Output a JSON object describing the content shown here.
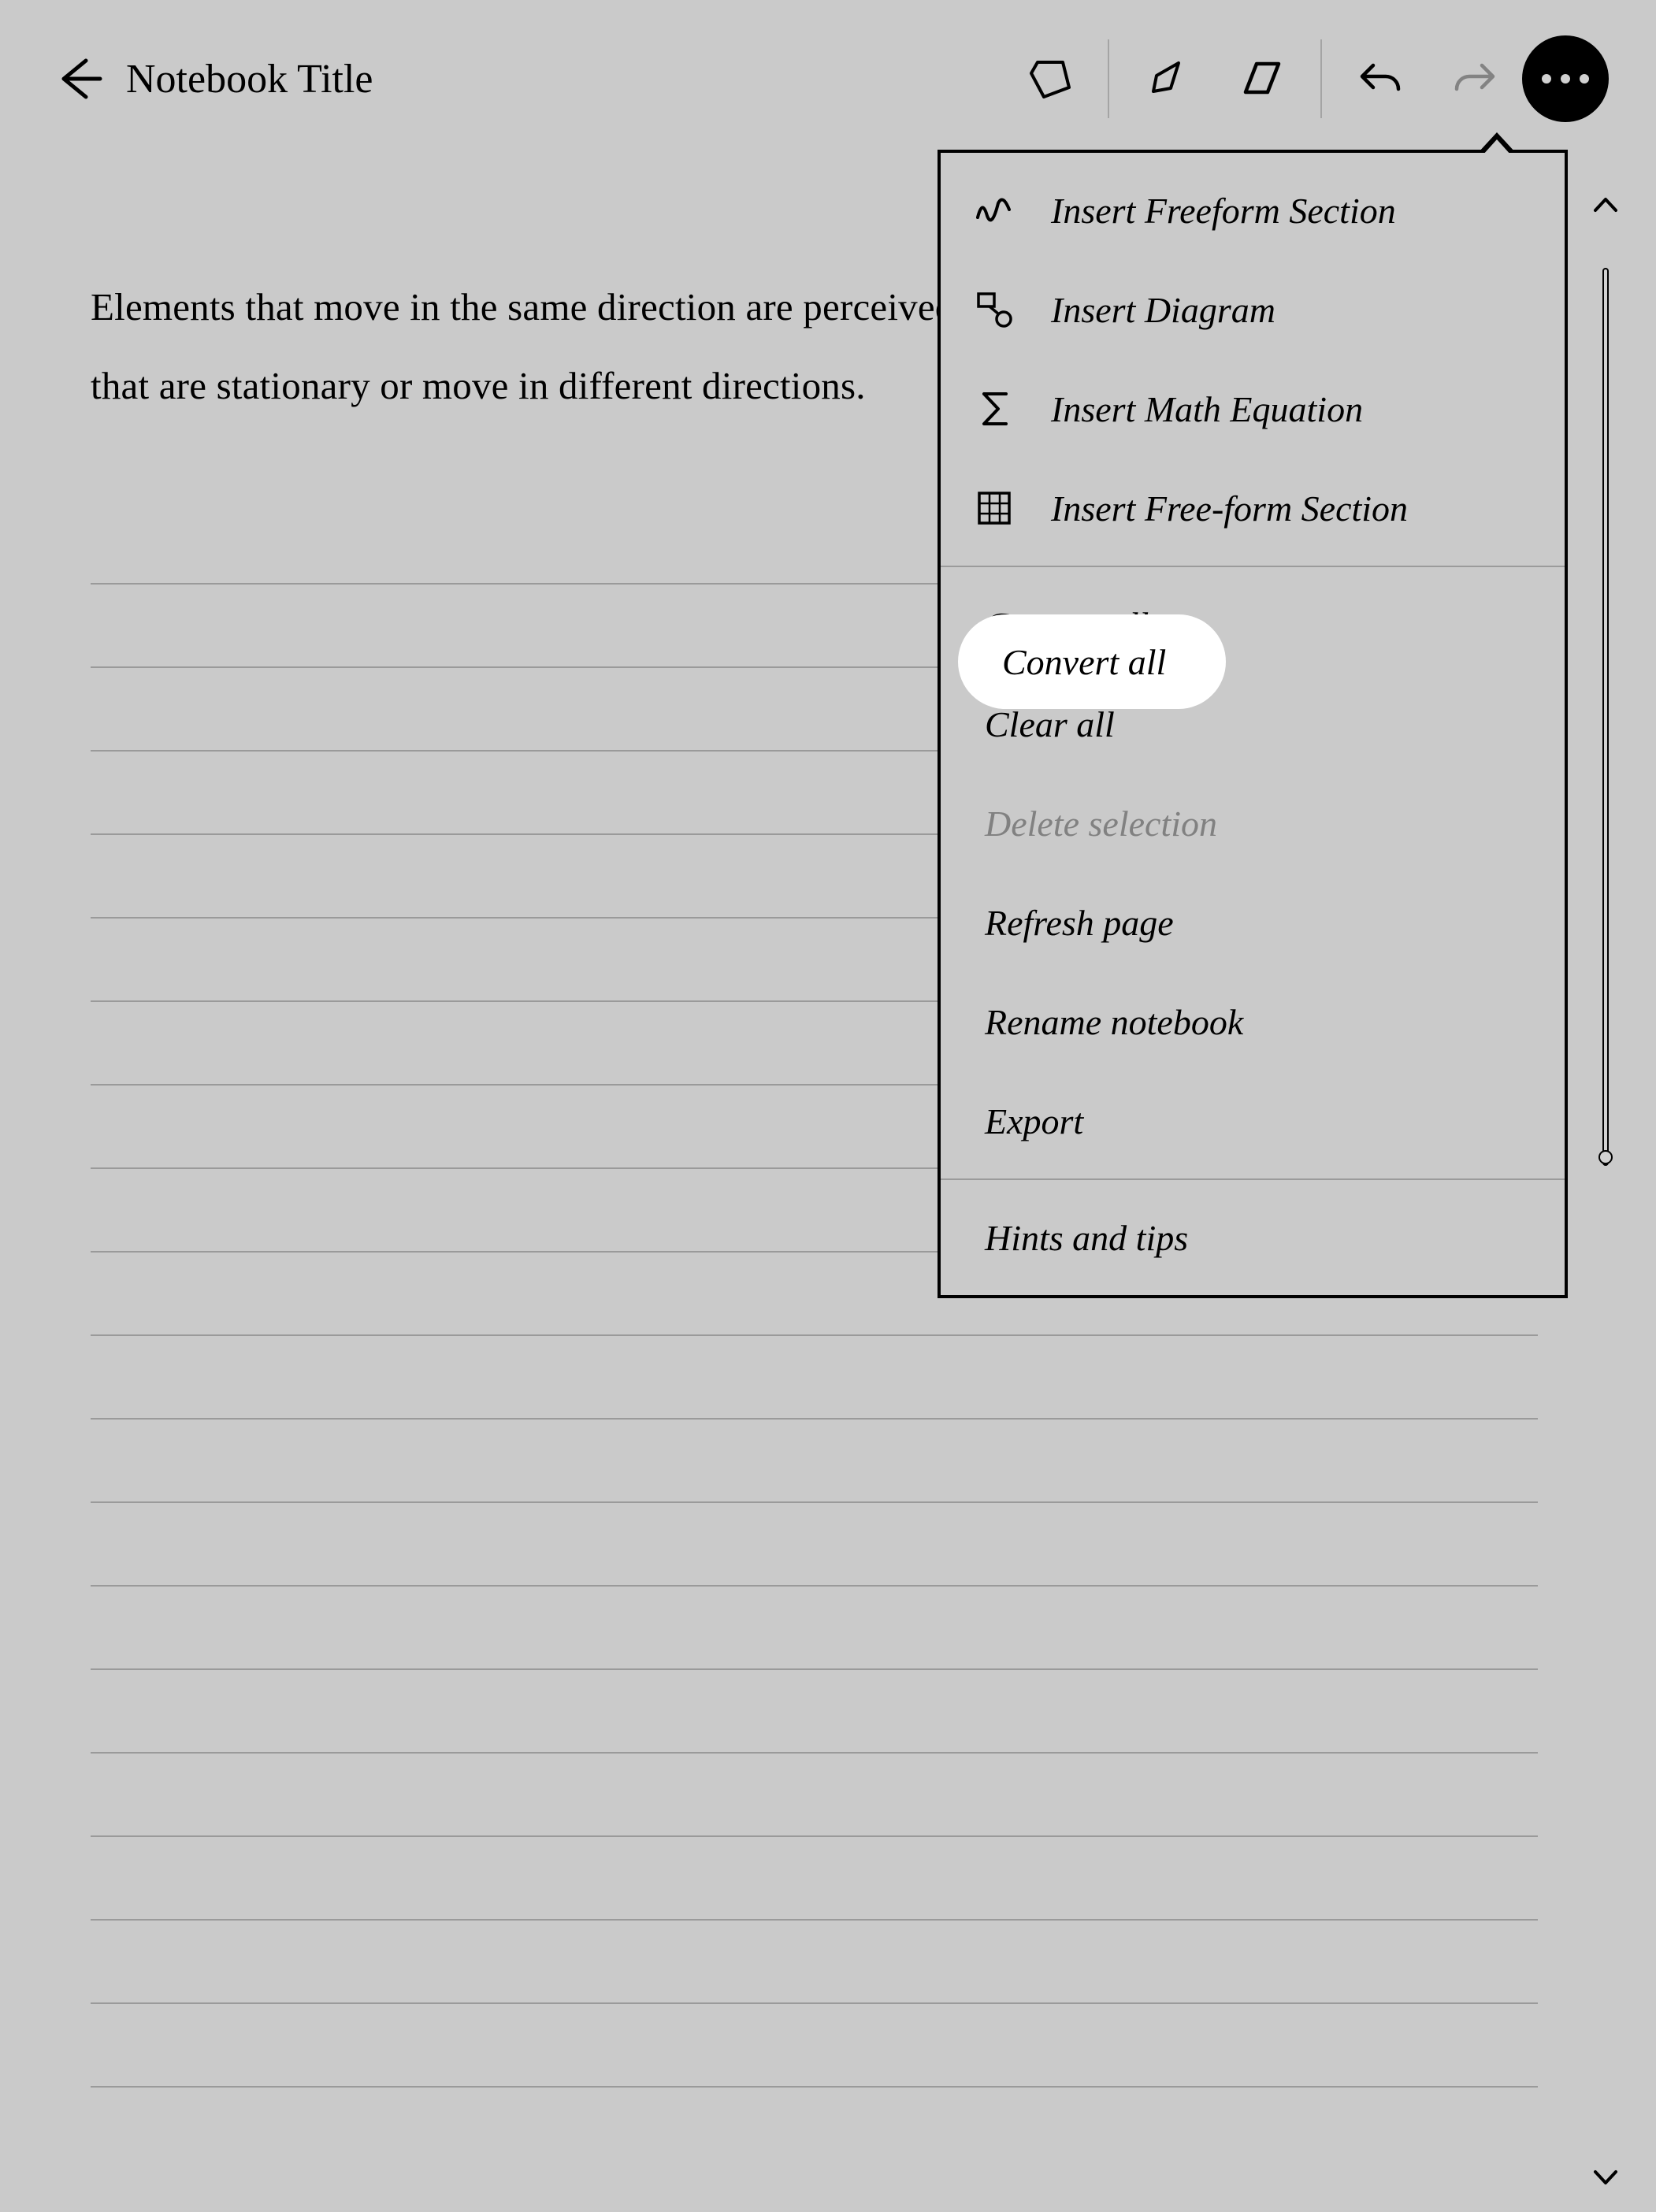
{
  "header": {
    "title": "Notebook Title"
  },
  "document": {
    "paragraph": "Elements that move in the same direction are perceived as being more related than elements that are stationary or move in different directions."
  },
  "menu": {
    "insert_items": [
      {
        "label": "Insert Freeform Section",
        "icon": "scribble"
      },
      {
        "label": "Insert Diagram",
        "icon": "diagram"
      },
      {
        "label": "Insert Math Equation",
        "icon": "sigma"
      },
      {
        "label": "Insert Free-form Section",
        "icon": "grid"
      }
    ],
    "actions": {
      "convert_all": "Convert all",
      "clear_all": "Clear all",
      "delete_selection": "Delete selection",
      "refresh_page": "Refresh page",
      "rename_notebook": "Rename notebook",
      "export": "Export"
    },
    "help": {
      "hints": "Hints and tips"
    }
  }
}
